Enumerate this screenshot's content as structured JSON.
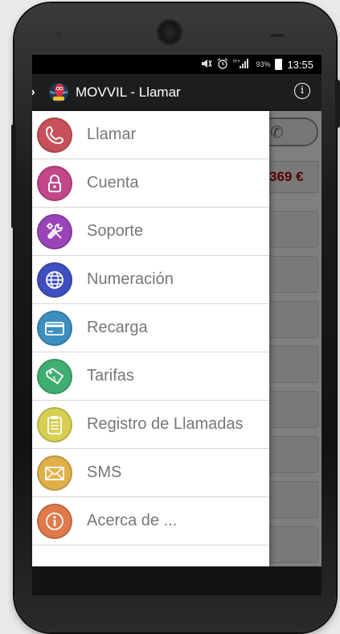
{
  "status_bar": {
    "mute_icon": "mute-icon",
    "alarm_icon": "alarm-icon",
    "network_icon": "hplus-signal-icon",
    "battery_percent": "93%",
    "time": "13:55"
  },
  "action_bar": {
    "title": "MOVVIL - Llamar",
    "info_glyph": "i"
  },
  "background": {
    "balance": "369 €"
  },
  "menu": {
    "items": [
      {
        "label": "Llamar",
        "icon": "phone-icon",
        "color": "#c8505a"
      },
      {
        "label": "Cuenta",
        "icon": "lock-icon",
        "color": "#c2468a"
      },
      {
        "label": "Soporte",
        "icon": "tools-icon",
        "color": "#9b44b8"
      },
      {
        "label": "Numeración",
        "icon": "globe-icon",
        "color": "#3f4fbf"
      },
      {
        "label": "Recarga",
        "icon": "credit-card-icon",
        "color": "#3d8fbf"
      },
      {
        "label": "Tarifas",
        "icon": "price-tag-icon",
        "color": "#3fae70"
      },
      {
        "label": "Registro de Llamadas",
        "icon": "clipboard-icon",
        "color": "#d6cf52"
      },
      {
        "label": "SMS",
        "icon": "envelope-icon",
        "color": "#e0b048"
      },
      {
        "label": "Acerca de ...",
        "icon": "info-icon",
        "color": "#df7a4a"
      }
    ]
  }
}
